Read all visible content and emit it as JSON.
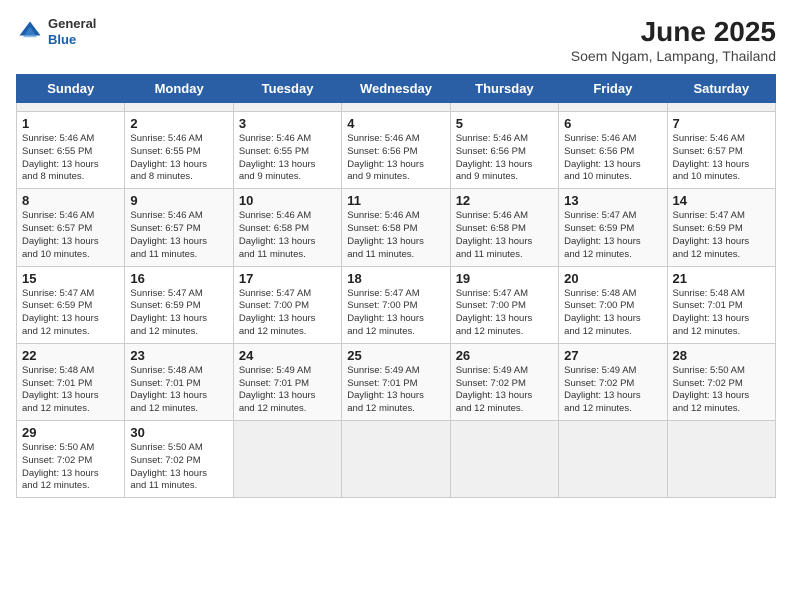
{
  "header": {
    "logo_general": "General",
    "logo_blue": "Blue",
    "title": "June 2025",
    "subtitle": "Soem Ngam, Lampang, Thailand"
  },
  "calendar": {
    "days_of_week": [
      "Sunday",
      "Monday",
      "Tuesday",
      "Wednesday",
      "Thursday",
      "Friday",
      "Saturday"
    ],
    "weeks": [
      [
        {
          "day": "",
          "info": ""
        },
        {
          "day": "",
          "info": ""
        },
        {
          "day": "",
          "info": ""
        },
        {
          "day": "",
          "info": ""
        },
        {
          "day": "",
          "info": ""
        },
        {
          "day": "",
          "info": ""
        },
        {
          "day": "",
          "info": ""
        }
      ],
      [
        {
          "day": "1",
          "info": "Sunrise: 5:46 AM\nSunset: 6:55 PM\nDaylight: 13 hours\nand 8 minutes."
        },
        {
          "day": "2",
          "info": "Sunrise: 5:46 AM\nSunset: 6:55 PM\nDaylight: 13 hours\nand 8 minutes."
        },
        {
          "day": "3",
          "info": "Sunrise: 5:46 AM\nSunset: 6:55 PM\nDaylight: 13 hours\nand 9 minutes."
        },
        {
          "day": "4",
          "info": "Sunrise: 5:46 AM\nSunset: 6:56 PM\nDaylight: 13 hours\nand 9 minutes."
        },
        {
          "day": "5",
          "info": "Sunrise: 5:46 AM\nSunset: 6:56 PM\nDaylight: 13 hours\nand 9 minutes."
        },
        {
          "day": "6",
          "info": "Sunrise: 5:46 AM\nSunset: 6:56 PM\nDaylight: 13 hours\nand 10 minutes."
        },
        {
          "day": "7",
          "info": "Sunrise: 5:46 AM\nSunset: 6:57 PM\nDaylight: 13 hours\nand 10 minutes."
        }
      ],
      [
        {
          "day": "8",
          "info": "Sunrise: 5:46 AM\nSunset: 6:57 PM\nDaylight: 13 hours\nand 10 minutes."
        },
        {
          "day": "9",
          "info": "Sunrise: 5:46 AM\nSunset: 6:57 PM\nDaylight: 13 hours\nand 11 minutes."
        },
        {
          "day": "10",
          "info": "Sunrise: 5:46 AM\nSunset: 6:58 PM\nDaylight: 13 hours\nand 11 minutes."
        },
        {
          "day": "11",
          "info": "Sunrise: 5:46 AM\nSunset: 6:58 PM\nDaylight: 13 hours\nand 11 minutes."
        },
        {
          "day": "12",
          "info": "Sunrise: 5:46 AM\nSunset: 6:58 PM\nDaylight: 13 hours\nand 11 minutes."
        },
        {
          "day": "13",
          "info": "Sunrise: 5:47 AM\nSunset: 6:59 PM\nDaylight: 13 hours\nand 12 minutes."
        },
        {
          "day": "14",
          "info": "Sunrise: 5:47 AM\nSunset: 6:59 PM\nDaylight: 13 hours\nand 12 minutes."
        }
      ],
      [
        {
          "day": "15",
          "info": "Sunrise: 5:47 AM\nSunset: 6:59 PM\nDaylight: 13 hours\nand 12 minutes."
        },
        {
          "day": "16",
          "info": "Sunrise: 5:47 AM\nSunset: 6:59 PM\nDaylight: 13 hours\nand 12 minutes."
        },
        {
          "day": "17",
          "info": "Sunrise: 5:47 AM\nSunset: 7:00 PM\nDaylight: 13 hours\nand 12 minutes."
        },
        {
          "day": "18",
          "info": "Sunrise: 5:47 AM\nSunset: 7:00 PM\nDaylight: 13 hours\nand 12 minutes."
        },
        {
          "day": "19",
          "info": "Sunrise: 5:47 AM\nSunset: 7:00 PM\nDaylight: 13 hours\nand 12 minutes."
        },
        {
          "day": "20",
          "info": "Sunrise: 5:48 AM\nSunset: 7:00 PM\nDaylight: 13 hours\nand 12 minutes."
        },
        {
          "day": "21",
          "info": "Sunrise: 5:48 AM\nSunset: 7:01 PM\nDaylight: 13 hours\nand 12 minutes."
        }
      ],
      [
        {
          "day": "22",
          "info": "Sunrise: 5:48 AM\nSunset: 7:01 PM\nDaylight: 13 hours\nand 12 minutes."
        },
        {
          "day": "23",
          "info": "Sunrise: 5:48 AM\nSunset: 7:01 PM\nDaylight: 13 hours\nand 12 minutes."
        },
        {
          "day": "24",
          "info": "Sunrise: 5:49 AM\nSunset: 7:01 PM\nDaylight: 13 hours\nand 12 minutes."
        },
        {
          "day": "25",
          "info": "Sunrise: 5:49 AM\nSunset: 7:01 PM\nDaylight: 13 hours\nand 12 minutes."
        },
        {
          "day": "26",
          "info": "Sunrise: 5:49 AM\nSunset: 7:02 PM\nDaylight: 13 hours\nand 12 minutes."
        },
        {
          "day": "27",
          "info": "Sunrise: 5:49 AM\nSunset: 7:02 PM\nDaylight: 13 hours\nand 12 minutes."
        },
        {
          "day": "28",
          "info": "Sunrise: 5:50 AM\nSunset: 7:02 PM\nDaylight: 13 hours\nand 12 minutes."
        }
      ],
      [
        {
          "day": "29",
          "info": "Sunrise: 5:50 AM\nSunset: 7:02 PM\nDaylight: 13 hours\nand 12 minutes."
        },
        {
          "day": "30",
          "info": "Sunrise: 5:50 AM\nSunset: 7:02 PM\nDaylight: 13 hours\nand 11 minutes."
        },
        {
          "day": "",
          "info": ""
        },
        {
          "day": "",
          "info": ""
        },
        {
          "day": "",
          "info": ""
        },
        {
          "day": "",
          "info": ""
        },
        {
          "day": "",
          "info": ""
        }
      ]
    ]
  }
}
